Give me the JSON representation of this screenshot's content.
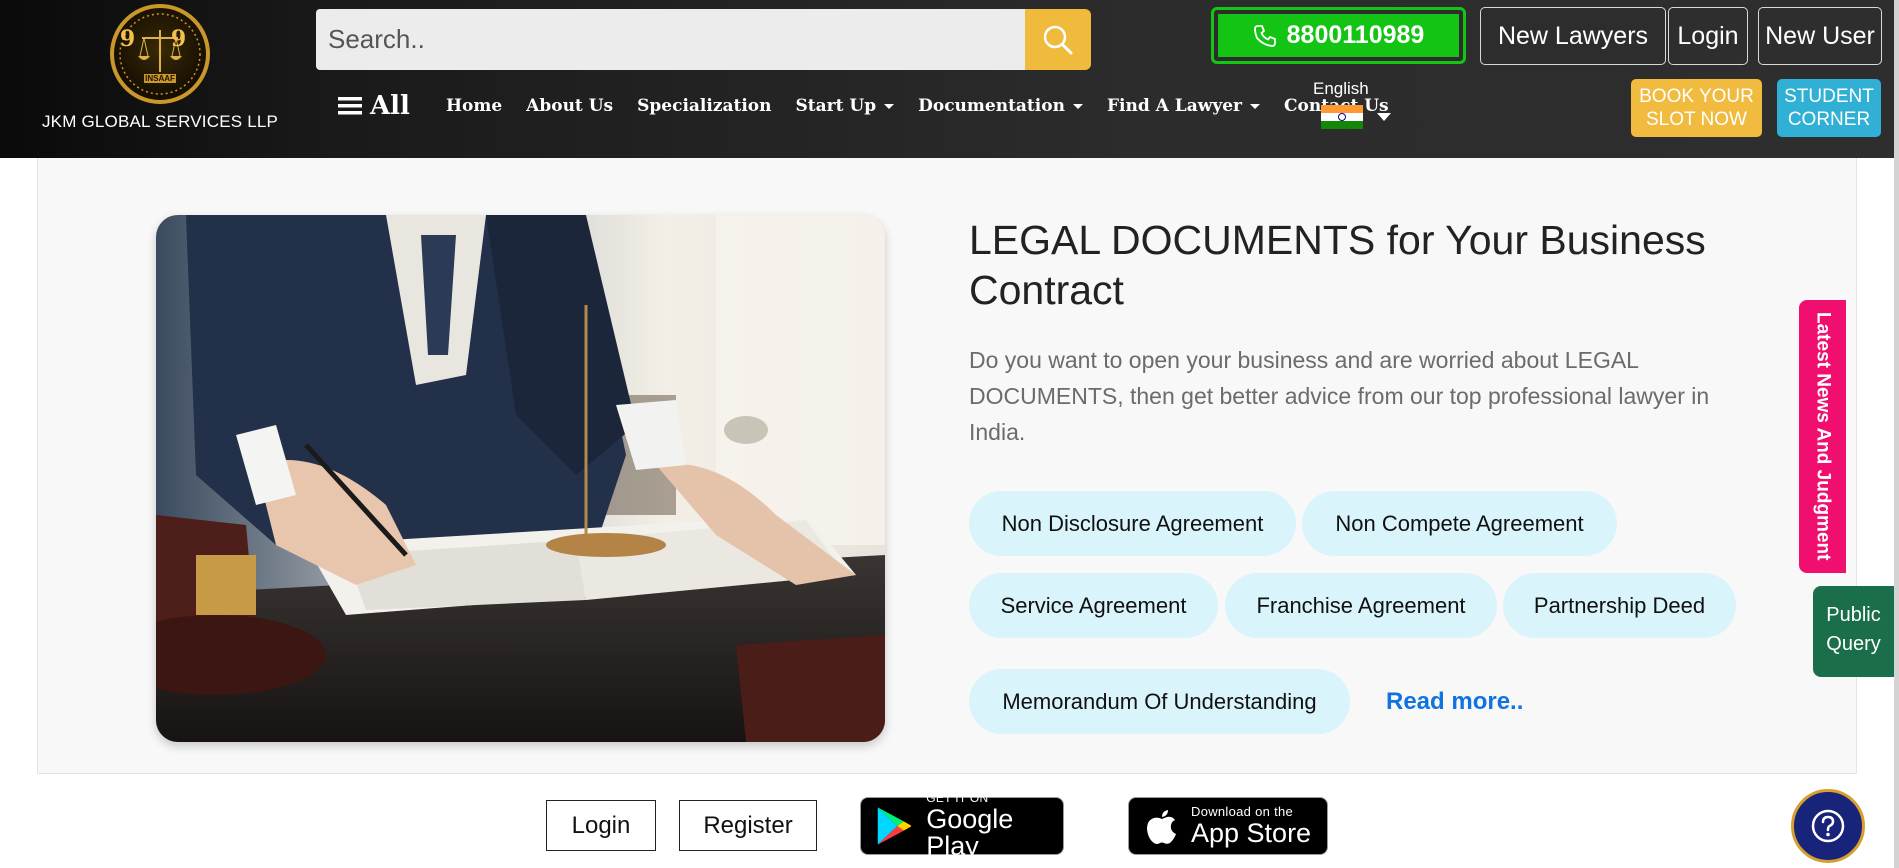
{
  "brand": {
    "name": "JKM GLOBAL SERVICES LLP",
    "emblem_digits": "9 9",
    "emblem_word": "INSAAF"
  },
  "search": {
    "placeholder": "Search.."
  },
  "header": {
    "phone": "8800110989",
    "new_lawyers": "New Lawyers",
    "login": "Login",
    "new_user": "New User",
    "book_slot_line1": "BOOK YOUR",
    "book_slot_line2": "SLOT NOW",
    "student_line1": "STUDENT",
    "student_line2": "CORNER"
  },
  "nav": {
    "all": "All",
    "items": [
      "Home",
      "About Us",
      "Specialization",
      "Start Up",
      "Documentation",
      "Find A Lawyer",
      "Contact Us"
    ]
  },
  "language": {
    "label": "English"
  },
  "hero": {
    "title": "LEGAL DOCUMENTS for Your Business Contract",
    "description": "Do you want to open your business and are worried about LEGAL DOCUMENTS, then get better advice from our top professional lawyer in India.",
    "pills": [
      "Non Disclosure Agreement",
      "Non Compete Agreement",
      "Service Agreement",
      "Franchise Agreement",
      "Partnership Deed",
      "Memorandum Of Understanding"
    ],
    "read_more": "Read more.."
  },
  "side": {
    "news": "Latest News And Judgment",
    "query_line1": "Public",
    "query_line2": "Query"
  },
  "footer": {
    "login": "Login",
    "register": "Register",
    "google_small": "GET IT ON",
    "google_big": "Google Play",
    "apple_small": "Download on the",
    "apple_big": "App Store"
  },
  "colors": {
    "accent_yellow": "#f0bb3e",
    "phone_green": "#14c414",
    "student_blue": "#2fb0d4",
    "news_pink": "#f00e6e",
    "query_green": "#1a6e4a",
    "link_blue": "#1173e0",
    "pill_bg": "#d9f4fb",
    "help_navy": "#18237a"
  },
  "icons": [
    "search-icon",
    "phone-icon",
    "menu-icon",
    "india-flag-icon",
    "google-play-icon",
    "apple-icon",
    "help-icon"
  ]
}
